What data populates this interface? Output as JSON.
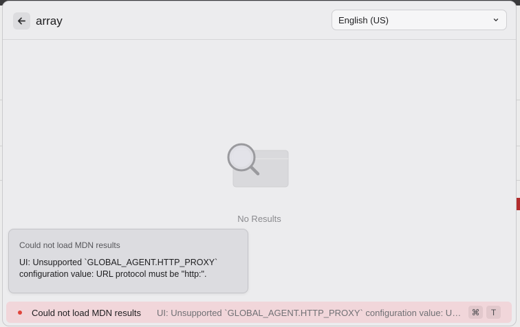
{
  "header": {
    "search_query": "array",
    "language_selected": "English (US)"
  },
  "empty_state": {
    "label": "No Results"
  },
  "toast": {
    "title": "Could not load MDN results",
    "message": "UI: Unsupported `GLOBAL_AGENT.HTTP_PROXY` configuration value: URL protocol must be \"http:\"."
  },
  "status_bar": {
    "title": "Could not load MDN results",
    "message": "UI: Unsupported `GLOBAL_AGENT.HTTP_PROXY` configuration value: URL protocol must be \"http:\".",
    "shortcut_keys": [
      "⌘",
      "T"
    ],
    "indicator_color": "#e0453c"
  },
  "icons": {
    "back": "arrow-left-icon",
    "dropdown": "chevron-down-icon",
    "empty": "magnifier-empty-icon"
  }
}
